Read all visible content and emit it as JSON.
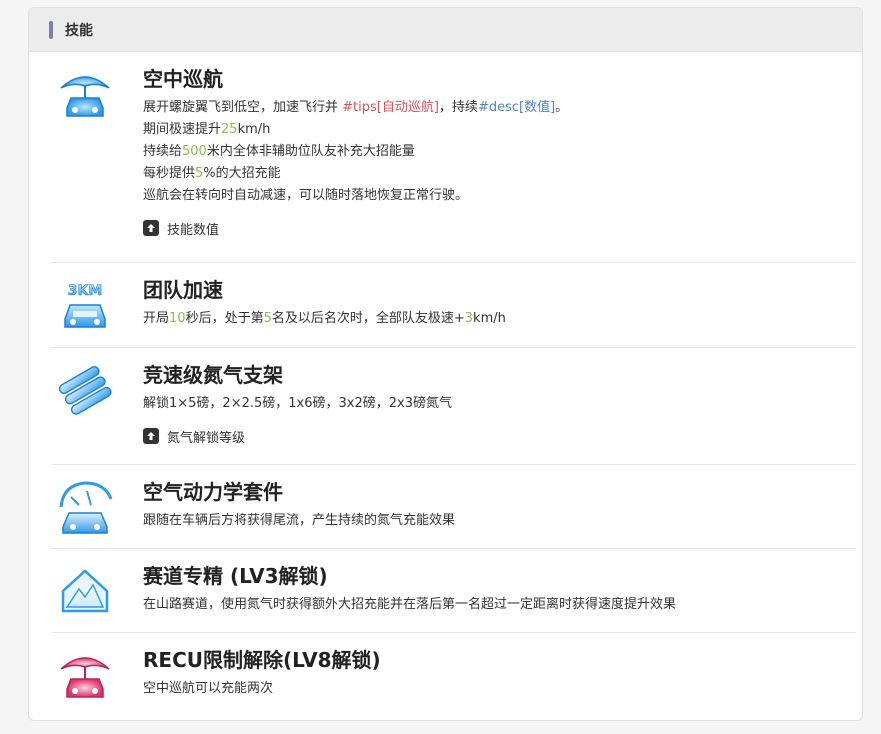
{
  "section": {
    "title": "技能"
  },
  "skills": [
    {
      "title": "空中巡航",
      "desc1_a": "展开螺旋翼飞到低空，加速飞行并 ",
      "desc1_tip": "#tips[自动巡航]",
      "desc1_b": "，持续",
      "desc1_desc": "#desc[数值]",
      "desc1_c": "。",
      "desc2_a": "期间极速提升",
      "desc2_num": "25",
      "desc2_b": "km/h",
      "desc3_a": "持续给",
      "desc3_num": "500",
      "desc3_b": "米内全体非辅助位队友补充大招能量",
      "desc4_a": "每秒提供",
      "desc4_num": "5",
      "desc4_b": "%的大招充能",
      "desc5": "巡航会在转向时自动减速，可以随时落地恢复正常行驶。",
      "upgrade_label": "技能数值",
      "icon": "helicopter-car-icon"
    },
    {
      "title": "团队加速",
      "desc_a": "开局",
      "desc_num1": "10",
      "desc_b": "秒后，处于第",
      "desc_num2": "5",
      "desc_c": "名及以后名次时，全部队友极速+",
      "desc_num3": "3",
      "desc_d": "km/h",
      "icon_text": "3KM",
      "icon": "team-speed-icon"
    },
    {
      "title": "竞速级氮气支架",
      "desc": "解锁1×5磅，2×2.5磅，1x6磅，3x2磅，2x3磅氮气",
      "upgrade_label": "氮气解锁等级",
      "icon": "nitro-rack-icon"
    },
    {
      "title": "空气动力学套件",
      "desc": "跟随在车辆后方将获得尾流，产生持续的氮气充能效果",
      "icon": "aero-kit-icon"
    },
    {
      "title": "赛道专精 (LV3解锁)",
      "desc": "在山路赛道，使用氮气时获得额外大招充能并在落后第一名超过一定距离时获得速度提升效果",
      "icon": "mountain-track-icon"
    },
    {
      "title": "RECU限制解除(LV8解锁)",
      "desc": "空中巡航可以充能两次",
      "icon": "helicopter-car-pink-icon"
    }
  ],
  "colors": {
    "icon_blue": "#3aa4e8",
    "icon_pink": "#e0457a",
    "highlight_green": "#8dbb4f",
    "highlight_red": "#e0505a",
    "highlight_blue": "#4f86c6"
  }
}
